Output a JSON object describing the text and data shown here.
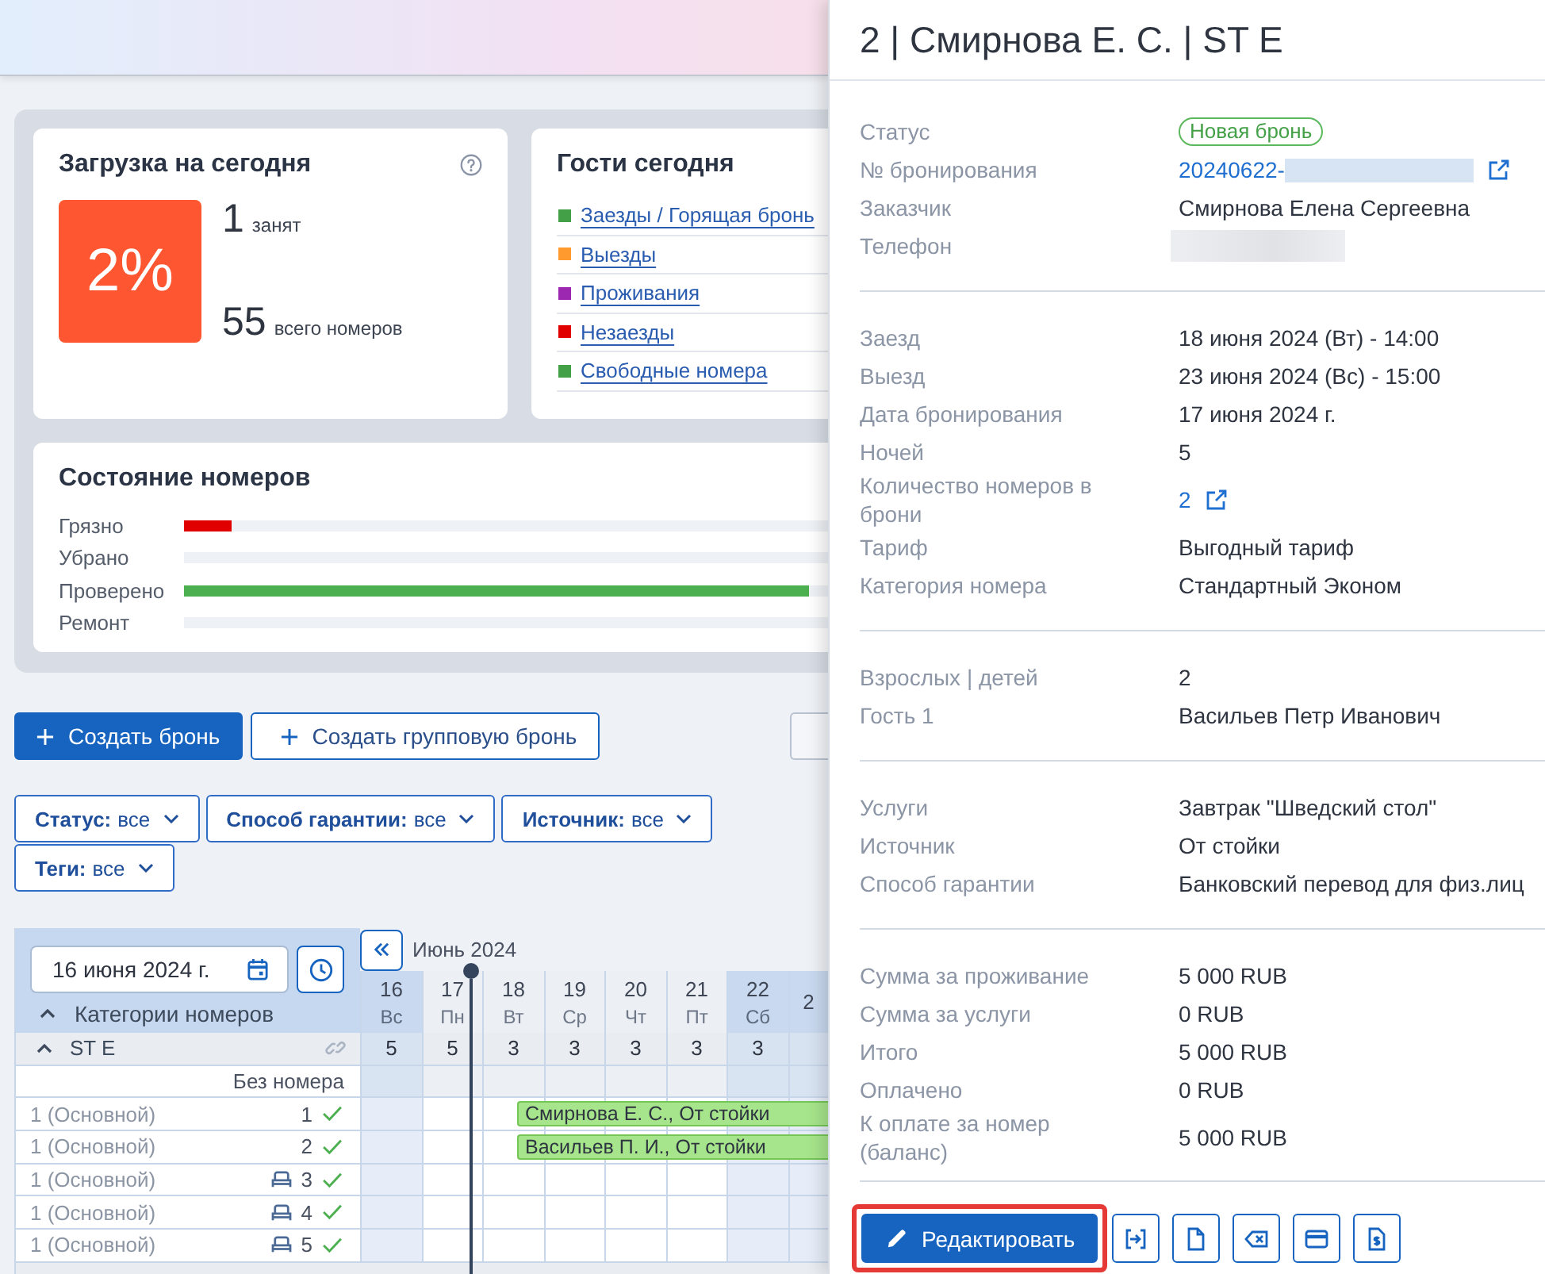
{
  "load_card": {
    "title": "Загрузка на сегодня",
    "percent": "2%",
    "occupied": "1",
    "occupied_label": "занят",
    "total": "55",
    "total_label": "всего номеров"
  },
  "guests_card": {
    "title": "Гости сегодня",
    "items": [
      {
        "label": "Заезды / Горящая бронь",
        "color": "#43a047"
      },
      {
        "label": "Выезды",
        "color": "#ff9a2e"
      },
      {
        "label": "Проживания",
        "color": "#9c27b0"
      },
      {
        "label": "Незаезды",
        "color": "#e00000"
      },
      {
        "label": "Свободные номера",
        "color": "#43a047"
      }
    ]
  },
  "room_state_card": {
    "title": "Состояние номеров",
    "rows": [
      {
        "label": "Грязно",
        "level": 0.074,
        "color": "#e00000"
      },
      {
        "label": "Убрано",
        "level": 0
      },
      {
        "label": "Проверено",
        "level": 0.97,
        "color": "#4caf50"
      },
      {
        "label": "Ремонт",
        "level": 0
      }
    ]
  },
  "actions": [
    {
      "label": "Создать бронь",
      "kind": "primary"
    },
    {
      "label": "Создать групповую бронь",
      "kind": "secondary"
    },
    {
      "kind": "cut_off"
    }
  ],
  "filters": [
    {
      "label": "Статус:",
      "value": "все"
    },
    {
      "label": "Способ гарантии:",
      "value": "все"
    },
    {
      "label": "Источник:",
      "value": "все"
    },
    {
      "label": "Теги:",
      "value": "все"
    }
  ],
  "calendar": {
    "date_field": {
      "value": "16 июня 2024 г."
    },
    "categories_label": "Категории номеров",
    "categories_expanded": true,
    "month": "Июнь 2024",
    "days": [
      {
        "day": "16",
        "weekday": "Вс",
        "count": "5",
        "weekend": true
      },
      {
        "day": "17",
        "weekday": "Пн",
        "count": "5",
        "weekend": false
      },
      {
        "day": "18",
        "weekday": "Вт",
        "count": "3",
        "weekend": false
      },
      {
        "day": "19",
        "weekday": "Ср",
        "count": "3",
        "weekend": false
      },
      {
        "day": "20",
        "weekday": "Чт",
        "count": "3",
        "weekend": false
      },
      {
        "day": "21",
        "weekday": "Пт",
        "count": "3",
        "weekend": false
      },
      {
        "day": "22",
        "weekday": "Сб",
        "count": "3",
        "weekend": true
      },
      {
        "day": "2",
        "weekend": true
      }
    ],
    "category": {
      "name": "ST E",
      "expanded": true
    },
    "unassigned_label": "Без номера",
    "rooms": [
      {
        "type": "1 (Основной)",
        "number": "1",
        "bed": false,
        "clean": true,
        "booking": {
          "label": "Смирнова Е. С., От стойки"
        }
      },
      {
        "type": "1 (Основной)",
        "number": "2",
        "bed": false,
        "clean": true,
        "booking": {
          "label": "Васильев П. И., От стойки"
        }
      },
      {
        "type": "1 (Основной)",
        "number": "3",
        "bed": true,
        "clean": true
      },
      {
        "type": "1 (Основной)",
        "number": "4",
        "bed": true,
        "clean": true
      },
      {
        "type": "1 (Основной)",
        "number": "5",
        "bed": true,
        "clean": true
      }
    ]
  },
  "booking_panel": {
    "title": "2 | Смирнова Е. С. | ST E",
    "sections": [
      {
        "rows": [
          {
            "label": "Статус",
            "value": "Новая бронь",
            "kind": "badge"
          },
          {
            "label": "№ бронирования",
            "value": "20240622-",
            "kind": "masked_link"
          },
          {
            "label": "Заказчик",
            "value": "Смирнова Елена Сергеевна",
            "kind": "text"
          },
          {
            "label": "Телефон",
            "kind": "masked"
          }
        ]
      },
      {
        "rows": [
          {
            "label": "Заезд",
            "value": "18 июня 2024 (Вт) - 14:00",
            "kind": "text"
          },
          {
            "label": "Выезд",
            "value": "23 июня 2024 (Вс) - 15:00",
            "kind": "text"
          },
          {
            "label": "Дата бронирования",
            "value": "17 июня 2024 г.",
            "kind": "text"
          },
          {
            "label": "Ночей",
            "value": "5",
            "kind": "text"
          },
          {
            "label": "Количество номеров в брони",
            "value": "2",
            "kind": "link"
          },
          {
            "label": "Тариф",
            "value": "Выгодный тариф",
            "kind": "text"
          },
          {
            "label": "Категория номера",
            "value": "Стандартный Эконом",
            "kind": "text"
          }
        ]
      },
      {
        "rows": [
          {
            "label": "Взрослых | детей",
            "value": "2",
            "kind": "text"
          },
          {
            "label": "Гость 1",
            "value": "Васильев Петр Иванович",
            "kind": "text"
          }
        ]
      },
      {
        "rows": [
          {
            "label": "Услуги",
            "value": "Завтрак \"Шведский стол\"",
            "kind": "text"
          },
          {
            "label": "Источник",
            "value": "От стойки",
            "kind": "text"
          },
          {
            "label": "Способ гарантии",
            "value": "Банковский перевод для физ.лиц",
            "kind": "text"
          }
        ]
      },
      {
        "rows": [
          {
            "label": "Сумма за проживание",
            "value": "5 000 RUB",
            "kind": "text"
          },
          {
            "label": "Сумма за услуги",
            "value": "0 RUB",
            "kind": "text"
          },
          {
            "label": "Итого",
            "value": "5 000 RUB",
            "kind": "text"
          },
          {
            "label": "Оплачено",
            "value": "0 RUB",
            "kind": "text"
          },
          {
            "label": "К оплате за номер (баланс)",
            "value": "5 000 RUB",
            "kind": "text"
          }
        ]
      }
    ],
    "buttons": [
      {
        "label": "Редактировать",
        "kind": "primary",
        "highlighted": true
      },
      {
        "kind": "icon",
        "highlighted": false
      },
      {
        "kind": "icon",
        "highlighted": false
      },
      {
        "kind": "icon",
        "highlighted": false
      },
      {
        "kind": "icon",
        "highlighted": false
      },
      {
        "kind": "icon",
        "highlighted": false
      }
    ]
  }
}
